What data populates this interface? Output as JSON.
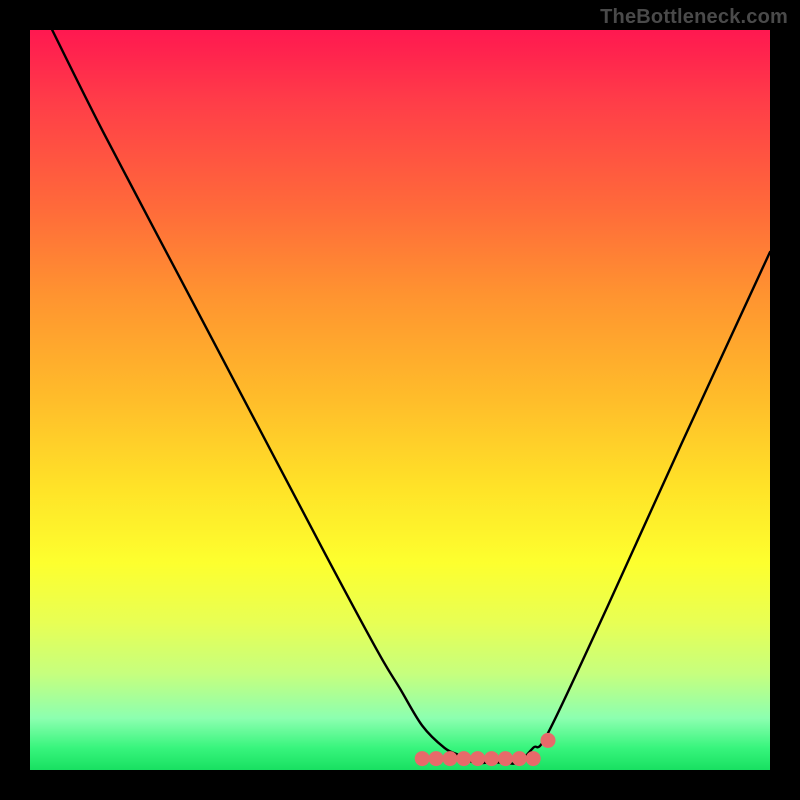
{
  "watermark": "TheBottleneck.com",
  "colors": {
    "background": "#000000",
    "gradient_top": "#ff1850",
    "gradient_bottom": "#18e061",
    "curve": "#000000",
    "marker_fill": "#e76a6a",
    "marker_stroke": "#c84a4a"
  },
  "chart_data": {
    "type": "line",
    "title": "",
    "xlabel": "",
    "ylabel": "",
    "xlim": [
      0,
      100
    ],
    "ylim": [
      0,
      100
    ],
    "grid": false,
    "legend": false,
    "series": [
      {
        "name": "bottleneck-curve",
        "x": [
          3,
          10,
          20,
          30,
          40,
          47,
          50,
          53,
          56,
          58,
          60,
          62,
          64,
          66,
          68,
          70,
          78,
          88,
          100
        ],
        "y": [
          100,
          86,
          67,
          48,
          29,
          16,
          11,
          6,
          3,
          2,
          1,
          1,
          1,
          1,
          3,
          5,
          22,
          44,
          70
        ]
      }
    ],
    "markers": [
      {
        "name": "flat-region",
        "x_range": [
          53,
          68
        ],
        "y": 1
      }
    ]
  }
}
